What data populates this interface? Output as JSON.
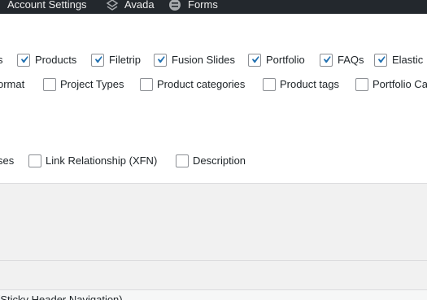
{
  "adminbar": {
    "account_settings": "Account Settings",
    "avada": "Avada",
    "forms": "Forms"
  },
  "row1": {
    "partial_left": "s",
    "items": [
      {
        "label": "Products",
        "checked": true
      },
      {
        "label": "Filetrip",
        "checked": true
      },
      {
        "label": "Fusion Slides",
        "checked": true
      },
      {
        "label": "Portfolio",
        "checked": true
      },
      {
        "label": "FAQs",
        "checked": true
      },
      {
        "label": "Elastic",
        "checked": true
      }
    ]
  },
  "row2": {
    "partial_left": "ormat",
    "items": [
      {
        "label": "Project Types",
        "checked": false
      },
      {
        "label": "Product categories",
        "checked": false
      },
      {
        "label": "Product tags",
        "checked": false
      },
      {
        "label": "Portfolio Ca",
        "checked": false
      }
    ]
  },
  "row3": {
    "partial_left": "ses",
    "items": [
      {
        "label": "Link Relationship (XFN)",
        "checked": false
      },
      {
        "label": "Description",
        "checked": false
      }
    ]
  },
  "bottom_text": "(Sticky Header Navigation)",
  "colors": {
    "check": "#2271b1",
    "adminbar": "#23282d"
  }
}
